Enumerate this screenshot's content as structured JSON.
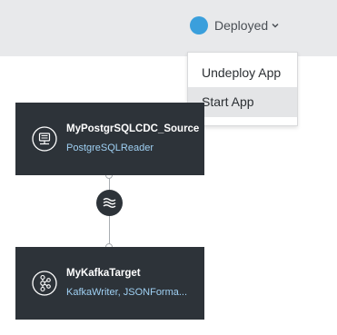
{
  "header": {
    "status_label": "Deployed",
    "status_color": "#3a9fdc",
    "dropdown_icon": "chevron-down-icon"
  },
  "menu": {
    "items": [
      {
        "label": "Undeploy App"
      },
      {
        "label": "Start App"
      }
    ]
  },
  "flow": {
    "nodes": [
      {
        "title": "MyPostgrSQLCDC_Source",
        "subtitle": "PostgreSQLReader",
        "icon": "database-reader-icon"
      },
      {
        "title": "MyKafkaTarget",
        "subtitle": "KafkaWriter, JSONForma...",
        "icon": "kafka-icon"
      }
    ],
    "stream_icon": "stream-waves-icon"
  }
}
